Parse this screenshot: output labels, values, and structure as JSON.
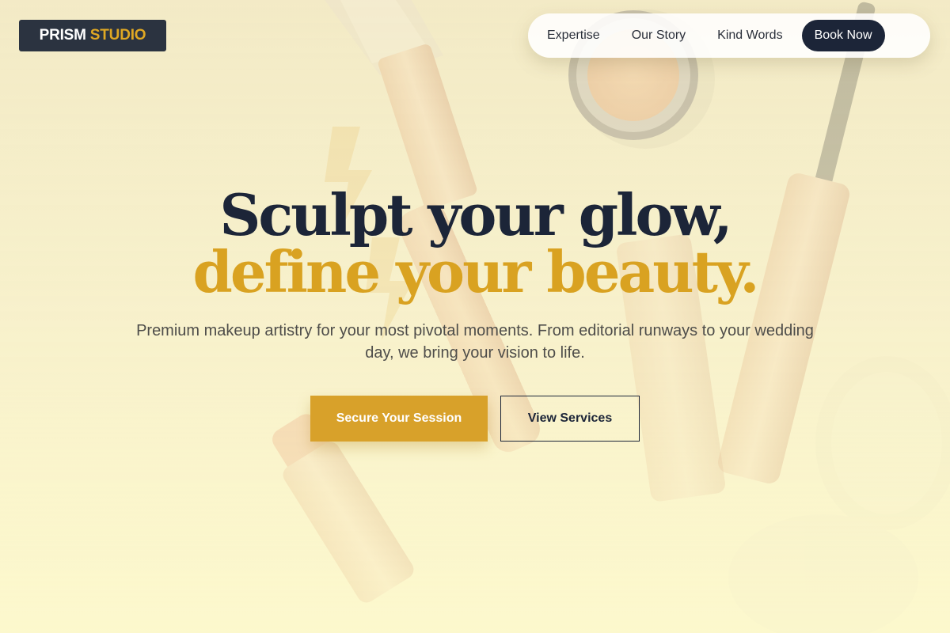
{
  "brand": {
    "name_part1": "PRISM",
    "name_part2": "STUDIO"
  },
  "nav": {
    "items": [
      {
        "label": "Expertise"
      },
      {
        "label": "Our Story"
      },
      {
        "label": "Kind Words"
      }
    ],
    "cta_label": "Book Now"
  },
  "hero": {
    "headline_line1": "Sculpt your glow,",
    "headline_line2": "define your beauty.",
    "subtext": "Premium makeup artistry for your most pivotal moments. From editorial runways to your wedding day, we bring your vision to life.",
    "primary_cta": "Secure Your Session",
    "secondary_cta": "View Services"
  },
  "background": {
    "image_subject": "makeup-products-flatlay"
  },
  "colors": {
    "navy": "#1c2538",
    "gold": "#d9a221",
    "logo_bg": "#2b3340",
    "cream": "#f4ebc4"
  }
}
